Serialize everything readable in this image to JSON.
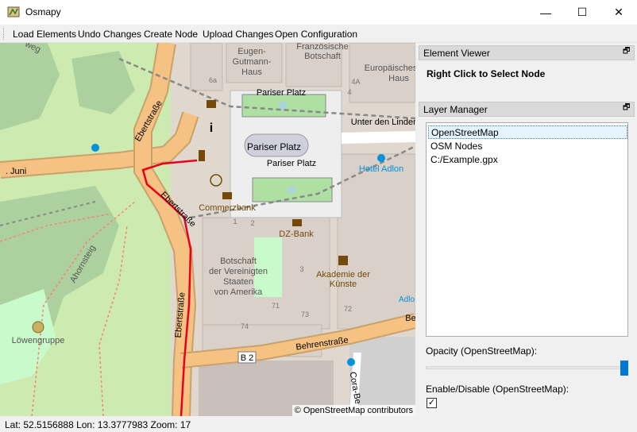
{
  "window": {
    "title": "Osmapy",
    "minimize_glyph": "—",
    "maximize_glyph": "☐",
    "close_glyph": "✕"
  },
  "menu": {
    "items": [
      "Load Elements",
      "Undo Changes",
      "Create Node",
      "Upload Changes",
      "Open Configuration"
    ]
  },
  "map": {
    "attribution": "© OpenStreetMap contributors",
    "labels": {
      "eugen": "Eugen-",
      "gutmann": "Gutmann-",
      "haus": "Haus",
      "franz1": "Französische",
      "franz2": "Botschaft",
      "europ1": "Europäisches",
      "europ2": "Haus",
      "pariser_platz_top": "Pariser Platz",
      "pariser_platz_mid": "Pariser Platz",
      "pariser_platz_bot": "Pariser Platz",
      "unter_den_linden": "Unter den Linden",
      "hotel_adlon": "Hotel Adlon",
      "commerzbank": "Commerzbank",
      "dz_bank": "DZ-Bank",
      "botschaft1": "Botschaft",
      "botschaft2": "der Vereinigten",
      "botschaft3": "Staaten",
      "botschaft4": "von Amerika",
      "akademie1": "Akademie der",
      "akademie2": "Künste",
      "ebertstr1": "Ebertstraße",
      "ebertstr2": "Ebertstraße",
      "ebertstr3": "Ebertstraße",
      "behrenstr": "Behrenstraße",
      "b2": "B 2",
      "juni": ". Juni",
      "ahornsteig": "Ahornsteig",
      "loewen": "Löwengruppe",
      "cora": "Cora-Be",
      "weg": "weg",
      "adlo": "Adlo",
      "be": "Be",
      "n6a": "6a",
      "n4a": "4A",
      "n4": "4",
      "n1": "1",
      "n2": "2",
      "n3": "3",
      "n71": "71",
      "n72": "72",
      "n73": "73",
      "n74": "74"
    }
  },
  "element_viewer": {
    "title": "Element Viewer",
    "hint": "Right Click to Select Node"
  },
  "layer_manager": {
    "title": "Layer Manager",
    "layers": [
      "OpenStreetMap",
      "OSM Nodes",
      "C:/Example.gpx"
    ],
    "opacity_label": "Opacity (OpenStreetMap):",
    "opacity_value": 1.0,
    "enable_label": "Enable/Disable (OpenStreetMap):",
    "enabled": true,
    "check_glyph": "✓",
    "float_glyph": "🗗"
  },
  "status": {
    "text": "Lat: 52.5156888 Lon: 13.3777983 Zoom: 17"
  },
  "colors": {
    "accent": "#0078d7",
    "track_red": "#e8001c",
    "road_orange": "#f5c284",
    "park_green": "#c8facc"
  }
}
